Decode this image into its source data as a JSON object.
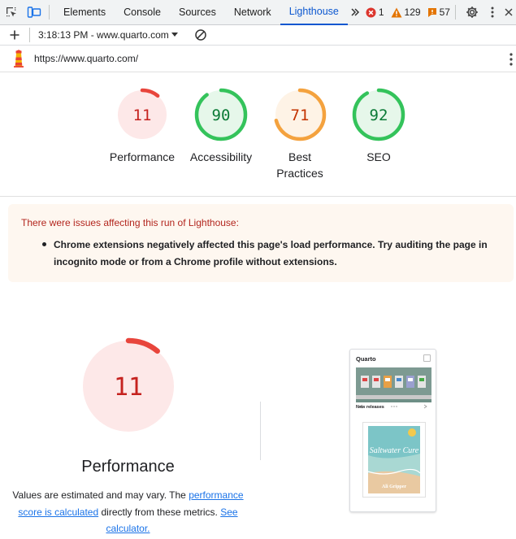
{
  "devtools": {
    "tabs": [
      {
        "label": "Elements",
        "active": false
      },
      {
        "label": "Console",
        "active": false
      },
      {
        "label": "Sources",
        "active": false
      },
      {
        "label": "Network",
        "active": false
      },
      {
        "label": "Lighthouse",
        "active": true
      }
    ],
    "errors": "1",
    "warnings": "129",
    "issues": "57"
  },
  "toolbar": {
    "run_label": "3:18:13 PM - www.quarto.com"
  },
  "report": {
    "url": "https://www.quarto.com/",
    "categories": [
      {
        "label": "Performance",
        "score": "11",
        "fraction": 0.11,
        "status": "fail"
      },
      {
        "label": "Accessibility",
        "score": "90",
        "fraction": 0.9,
        "status": "pass"
      },
      {
        "label": "Best Practices",
        "score": "71",
        "fraction": 0.71,
        "status": "average"
      },
      {
        "label": "SEO",
        "score": "92",
        "fraction": 0.92,
        "status": "pass"
      }
    ],
    "warning_title": "There were issues affecting this run of Lighthouse:",
    "warning_item": "Chrome extensions negatively affected this page's load performance. Try auditing the page in incognito mode or from a Chrome profile without extensions.",
    "performance": {
      "score": "11",
      "fraction": 0.11,
      "title": "Performance",
      "desc_1": "Values are estimated and may vary. The",
      "link_1": "performance score is calculated",
      "desc_2": "directly from these metrics.",
      "link_2": "See calculator."
    },
    "thumbnail": {
      "logo": "Quarto",
      "section": "New releases",
      "book_title": "Saltwater Cure",
      "book_author": "Ali Gripper"
    }
  },
  "colors": {
    "fail": "#e8453c",
    "fail_bg": "#fde8e8",
    "fail_text": "#c5221f",
    "average": "#f4a23e",
    "average_bg": "#fef3e6",
    "average_text": "#c33300",
    "pass": "#34c35b",
    "pass_bg": "#e6f7ea",
    "pass_text": "#0a7a36",
    "accent": "#0b57d0"
  },
  "icons": [
    "select-element-icon",
    "device-toolbar-icon",
    "more-tabs-icon",
    "error-icon",
    "warning-icon",
    "issues-icon",
    "settings-gear-icon",
    "kebab-menu-icon",
    "close-icon",
    "add-icon",
    "clear-icon",
    "dropdown-arrow-icon",
    "lighthouse-logo-icon"
  ]
}
